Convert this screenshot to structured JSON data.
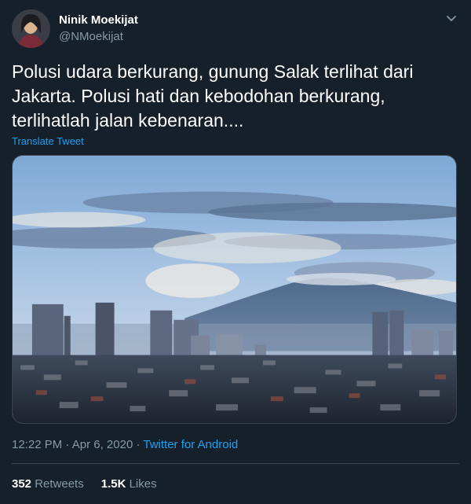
{
  "user": {
    "name": "Ninik Moekijat",
    "handle": "@NMoekijat"
  },
  "tweet": {
    "text": "Polusi udara berkurang, gunung Salak terlihat dari\nJakarta.  Polusi hati dan kebodohan berkurang,\nterlihatlah jalan kebenaran....",
    "translate_label": "Translate Tweet"
  },
  "meta": {
    "time": "12:22 PM",
    "separator1": " · ",
    "date": "Apr 6, 2020",
    "separator2": " · ",
    "source": "Twitter for Android"
  },
  "stats": {
    "retweets_count": "352",
    "retweets_label": " Retweets",
    "likes_count": "1.5K",
    "likes_label": " Likes"
  },
  "icons": {
    "caret": "chevron-down-icon"
  },
  "colors": {
    "background": "#15202b",
    "accent": "#1da1f2",
    "secondary_text": "#8899a6"
  }
}
